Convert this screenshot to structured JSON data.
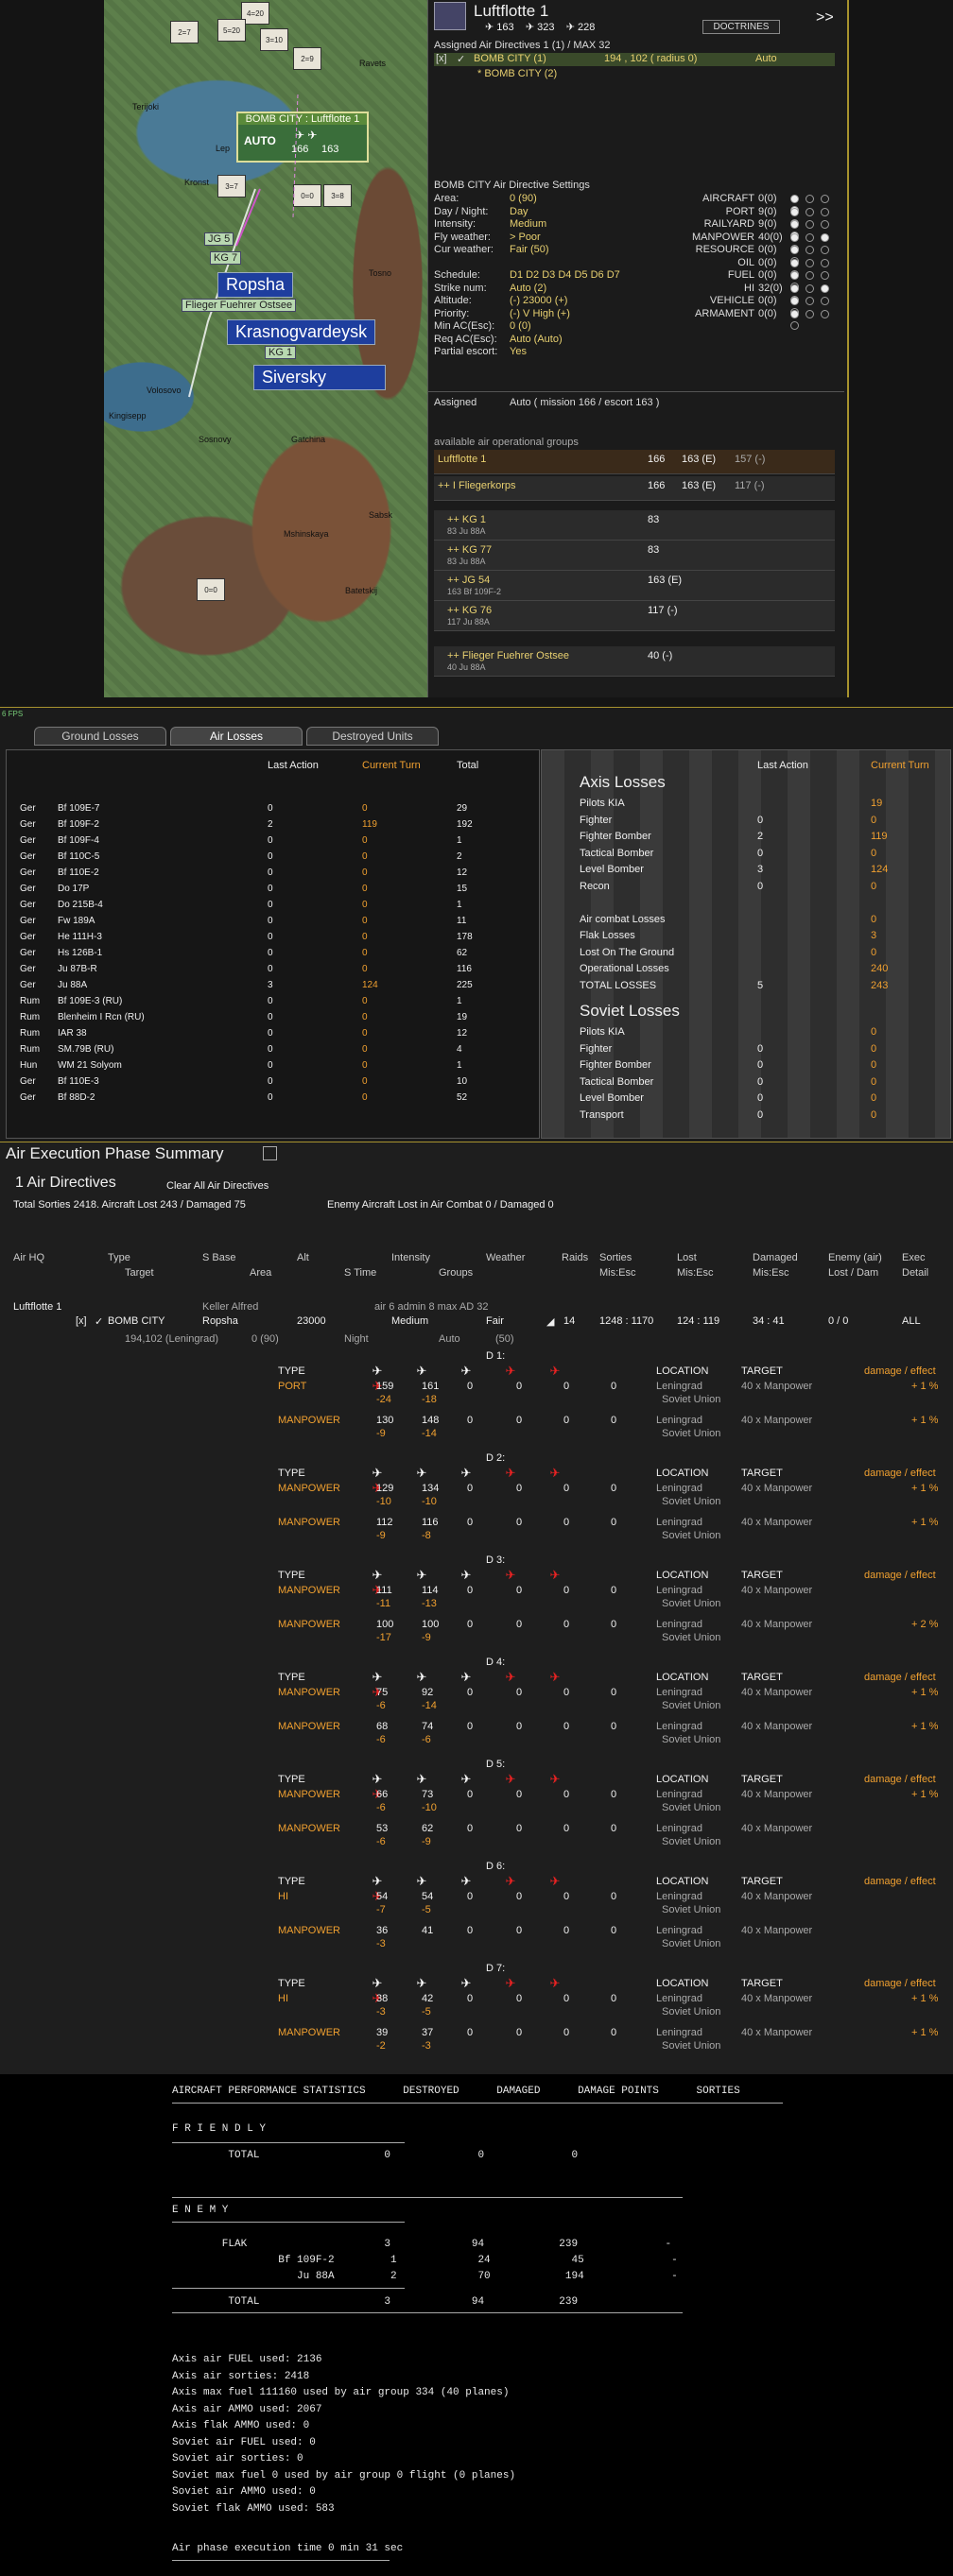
{
  "map": {
    "popup_title": "BOMB CITY : Luftflotte 1",
    "popup_mode": "AUTO",
    "popup_v1": "166",
    "popup_v2": "163",
    "cities": [
      "Terijoki",
      "Kronst",
      "Ravets",
      "Lep",
      "Tosno",
      "Volosovo",
      "Kingisepp",
      "Sosnovy",
      "Gatchina",
      "Mshinskaya",
      "Sabsk",
      "Batetskij"
    ],
    "labels": {
      "jg5": "JG 5",
      "kg7": "KG 7",
      "ffo": "Flieger Fuehrer Ostsee",
      "kg1": "KG 1"
    },
    "big": {
      "ropsha": "Ropsha",
      "kras": "Krasnogvardeysk",
      "siv": "Siversky"
    }
  },
  "panel": {
    "title": "Luftflotte 1",
    "s1": "163",
    "s2": "323",
    "s3": "228",
    "doctrines": "DOCTRINES",
    "next": ">>",
    "assigned_hdr": "Assigned Air Directives 1 (1) / MAX 32",
    "dir_x": "[x]",
    "dir_name": "BOMB CITY (1)",
    "dir_coord": "194 , 102 ( radius 0)",
    "dir_mode": "Auto",
    "dir_sub": "* BOMB CITY (2)",
    "settings_hdr": "BOMB CITY Air Directive Settings",
    "settings": [
      {
        "k": "Area:",
        "v": "0 (90)"
      },
      {
        "k": "Day / Night:",
        "v": "Day"
      },
      {
        "k": "Intensity:",
        "v": "Medium"
      },
      {
        "k": "Fly weather:",
        "v": "> Poor"
      },
      {
        "k": "Cur weather:",
        "v": "Fair (50)"
      },
      {
        "k": "",
        "v": ""
      },
      {
        "k": "Schedule:",
        "v": "D1 D2 D3 D4 D5 D6 D7"
      },
      {
        "k": "Strike num:",
        "v": "Auto (2)"
      },
      {
        "k": "Altitude:",
        "v": "(-) 23000 (+)"
      },
      {
        "k": "Priority:",
        "v": "(-) V High (+)"
      },
      {
        "k": "Min AC(Esc):",
        "v": "0 (0)"
      },
      {
        "k": "Req AC(Esc):",
        "v": "Auto (Auto)"
      },
      {
        "k": "Partial escort:",
        "v": "Yes"
      }
    ],
    "targets": [
      {
        "k": "AIRCRAFT",
        "v": "0(0)"
      },
      {
        "k": "PORT",
        "v": "9(0)"
      },
      {
        "k": "RAILYARD",
        "v": "9(0)"
      },
      {
        "k": "MANPOWER",
        "v": "40(0)"
      },
      {
        "k": "RESOURCE",
        "v": "0(0)"
      },
      {
        "k": "OIL",
        "v": "0(0)"
      },
      {
        "k": "FUEL",
        "v": "0(0)"
      },
      {
        "k": "HI",
        "v": "32(0)"
      },
      {
        "k": "VEHICLE",
        "v": "0(0)"
      },
      {
        "k": "ARMAMENT",
        "v": "0(0)"
      }
    ],
    "assigned_label": "Assigned",
    "assigned_val": "Auto  ( mission 166 / escort 163 )",
    "avail_hdr": "available air operational groups",
    "groups": [
      {
        "name": "Luftflotte 1",
        "sub": "",
        "a": "166",
        "b": "163 (E)",
        "c": "157 (-)"
      },
      {
        "name": "++ I Fliegerkorps",
        "sub": "",
        "a": "166",
        "b": "163 (E)",
        "c": "117 (-)"
      },
      {
        "name": "++ KG 1",
        "sub": "83 Ju 88A",
        "a": "83",
        "b": "",
        "c": ""
      },
      {
        "name": "++ KG 77",
        "sub": "83 Ju 88A",
        "a": "83",
        "b": "",
        "c": ""
      },
      {
        "name": "++ JG 54",
        "sub": "163 Bf 109F-2",
        "a": "163 (E)",
        "b": "",
        "c": ""
      },
      {
        "name": "++ KG 76",
        "sub": "117 Ju 88A",
        "a": "117 (-)",
        "b": "",
        "c": ""
      },
      {
        "name": "++ Flieger Fuehrer Ostsee",
        "sub": "40 Ju 88A",
        "a": "40 (-)",
        "b": "",
        "c": ""
      }
    ]
  },
  "fps": "6 FPS",
  "losses": {
    "tabs": [
      "Ground Losses",
      "Air Losses",
      "Destroyed Units"
    ],
    "cols": [
      "Last Action",
      "Current Turn",
      "Total"
    ],
    "rows": [
      [
        "Ger",
        "Bf 109E-7",
        "0",
        "0",
        "29"
      ],
      [
        "Ger",
        "Bf 109F-2",
        "2",
        "119",
        "192"
      ],
      [
        "Ger",
        "Bf 109F-4",
        "0",
        "0",
        "1"
      ],
      [
        "Ger",
        "Bf 110C-5",
        "0",
        "0",
        "2"
      ],
      [
        "Ger",
        "Bf 110E-2",
        "0",
        "0",
        "12"
      ],
      [
        "Ger",
        "Do 17P",
        "0",
        "0",
        "15"
      ],
      [
        "Ger",
        "Do 215B-4",
        "0",
        "0",
        "1"
      ],
      [
        "Ger",
        "Fw 189A",
        "0",
        "0",
        "11"
      ],
      [
        "Ger",
        "He 111H-3",
        "0",
        "0",
        "178"
      ],
      [
        "Ger",
        "Hs 126B-1",
        "0",
        "0",
        "62"
      ],
      [
        "Ger",
        "Ju 87B-R",
        "0",
        "0",
        "116"
      ],
      [
        "Ger",
        "Ju 88A",
        "3",
        "124",
        "225"
      ],
      [
        "Rum",
        "Bf 109E-3 (RU)",
        "0",
        "0",
        "1"
      ],
      [
        "Rum",
        "Blenheim I Rcn (RU)",
        "0",
        "0",
        "19"
      ],
      [
        "Rum",
        "IAR 38",
        "0",
        "0",
        "12"
      ],
      [
        "Rum",
        "SM.79B (RU)",
        "0",
        "0",
        "4"
      ],
      [
        "Hun",
        "WM 21 Solyom",
        "0",
        "0",
        "1"
      ],
      [
        "Ger",
        "Bf 110E-3",
        "0",
        "0",
        "10"
      ],
      [
        "Ger",
        "Bf 88D-2",
        "0",
        "0",
        "52"
      ]
    ],
    "axis_title": "Axis Losses",
    "axis_cols": [
      "Last Action",
      "Current Turn"
    ],
    "axis": [
      {
        "k": "Pilots KIA",
        "a": "",
        "b": "19"
      },
      {
        "k": "Fighter",
        "a": "0",
        "b": "0"
      },
      {
        "k": "Fighter Bomber",
        "a": "2",
        "b": "119"
      },
      {
        "k": "Tactical Bomber",
        "a": "0",
        "b": "0"
      },
      {
        "k": "Level Bomber",
        "a": "3",
        "b": "124"
      },
      {
        "k": "Recon",
        "a": "0",
        "b": "0"
      },
      {
        "k": "",
        "a": "",
        "b": ""
      },
      {
        "k": "Air combat Losses",
        "a": "",
        "b": "0"
      },
      {
        "k": "Flak Losses",
        "a": "",
        "b": "3"
      },
      {
        "k": "Lost On The Ground",
        "a": "",
        "b": "0"
      },
      {
        "k": "Operational Losses",
        "a": "",
        "b": "240"
      },
      {
        "k": "TOTAL LOSSES",
        "a": "5",
        "b": "243"
      }
    ],
    "soviet_title": "Soviet Losses",
    "soviet": [
      {
        "k": "Pilots KIA",
        "a": "",
        "b": "0"
      },
      {
        "k": "Fighter",
        "a": "0",
        "b": "0"
      },
      {
        "k": "Fighter Bomber",
        "a": "0",
        "b": "0"
      },
      {
        "k": "Tactical Bomber",
        "a": "0",
        "b": "0"
      },
      {
        "k": "Level Bomber",
        "a": "0",
        "b": "0"
      },
      {
        "k": "Transport",
        "a": "0",
        "b": "0"
      }
    ]
  },
  "aes": {
    "title": "Air Execution Phase Summary",
    "count": "1 Air Directives",
    "clear": "Clear All Air Directives",
    "totals": "Total Sorties 2418. Aircraft Lost 243 / Damaged 75",
    "enemy": "Enemy Aircraft Lost in Air Combat 0 / Damaged 0",
    "h1": [
      "Air HQ",
      "Type",
      "S Base",
      "Alt",
      "Intensity",
      "Weather",
      "Raids",
      "Sorties",
      "Lost",
      "Damaged",
      "Enemy (air)",
      "Exec"
    ],
    "h2": [
      "Target",
      "Area",
      "S Time",
      "Groups",
      "Mis:Esc",
      "Mis:Esc",
      "Mis:Esc",
      "Lost / Dam",
      "Detail"
    ],
    "hq": "Luftflotte 1",
    "cmdr": "Keller Alfred",
    "air": "air 6  admin 8  max AD 32",
    "dir": {
      "x": "[x]",
      "type": "BOMB CITY",
      "base": "Ropsha",
      "alt": "23000",
      "int": "Medium",
      "wx": "Fair",
      "raids": "14",
      "sorties": "1248 : 1170",
      "lost": "124 : 119",
      "dam": "34 : 41",
      "enemy": "0 / 0",
      "exec": "ALL",
      "coord": "194,102 (Leningrad)",
      "area": "0  (90)",
      "stime": "Night",
      "groups": "Auto",
      "wxv": "(50)"
    },
    "days": [
      {
        "d": "D 1:",
        "t": [
          "PORT",
          "MANPOWER"
        ],
        "v": [
          [
            "159",
            "161",
            "-24",
            "-18",
            "+ 1 %"
          ],
          [
            "130",
            "148",
            "-9",
            "-14",
            "+ 1 %"
          ]
        ]
      },
      {
        "d": "D 2:",
        "t": [
          "MANPOWER",
          "MANPOWER"
        ],
        "v": [
          [
            "129",
            "134",
            "-10",
            "-10",
            "+ 1 %"
          ],
          [
            "112",
            "116",
            "-9",
            "-8",
            "+ 1 %"
          ]
        ]
      },
      {
        "d": "D 3:",
        "t": [
          "MANPOWER",
          "MANPOWER"
        ],
        "v": [
          [
            "111",
            "114",
            "-11",
            "-13",
            ""
          ],
          [
            "100",
            "100",
            "-17",
            "-9",
            "+ 2 %"
          ]
        ]
      },
      {
        "d": "D 4:",
        "t": [
          "MANPOWER",
          "MANPOWER"
        ],
        "v": [
          [
            "75",
            "92",
            "-6",
            "-14",
            "+ 1 %"
          ],
          [
            "68",
            "74",
            "-6",
            "-6",
            "+ 1 %"
          ]
        ]
      },
      {
        "d": "D 5:",
        "t": [
          "MANPOWER",
          "MANPOWER"
        ],
        "v": [
          [
            "66",
            "73",
            "-6",
            "-10",
            "+ 1 %"
          ],
          [
            "53",
            "62",
            "-6",
            "-9",
            ""
          ]
        ]
      },
      {
        "d": "D 6:",
        "t": [
          "HI",
          "MANPOWER"
        ],
        "v": [
          [
            "54",
            "54",
            "-7",
            "-5",
            ""
          ],
          [
            "36",
            "41",
            "-3",
            "",
            ""
          ]
        ]
      },
      {
        "d": "D 7:",
        "t": [
          "HI",
          "MANPOWER"
        ],
        "v": [
          [
            "38",
            "42",
            "-3",
            "-5",
            "+ 1 %"
          ],
          [
            "39",
            "37",
            "-2",
            "-3",
            "+ 1 %"
          ]
        ]
      }
    ],
    "loc": "LOCATION",
    "tgt": "TARGET",
    "de": "damage / effect",
    "leningrad": "Leningrad",
    "su": "Soviet Union",
    "mp": "40 x Manpower",
    "type": "TYPE",
    "zero": "0"
  },
  "stats": {
    "hdr": "AIRCRAFT PERFORMANCE STATISTICS      DESTROYED      DAMAGED      DAMAGE POINTS      SORTIES",
    "friendly": "F R I E N D L Y",
    "ftotal": "         TOTAL                    0              0              0",
    "enemy": "E N E M Y",
    "flak": "        FLAK                      3             94            239              -",
    "bf": "                 Bf 109F-2         1             24             45              -",
    "ju": "                    Ju 88A         2             70            194              -",
    "etotal": "         TOTAL                    3             94            239",
    "lines": [
      "Axis air FUEL used: 2136",
      "Axis air sorties: 2418",
      "Axis max fuel 111160 used by air group 334 (40 planes)",
      "Axis air AMMO used: 2067",
      "Axis flak AMMO used: 0",
      "Soviet air FUEL used: 0",
      "Soviet air sorties: 0",
      "Soviet max fuel 0 used by air group 0 flight (0 planes)",
      "Soviet air AMMO used: 0",
      "Soviet flak AMMO used: 583"
    ],
    "time": "Air phase execution time 0 min 31 sec"
  }
}
